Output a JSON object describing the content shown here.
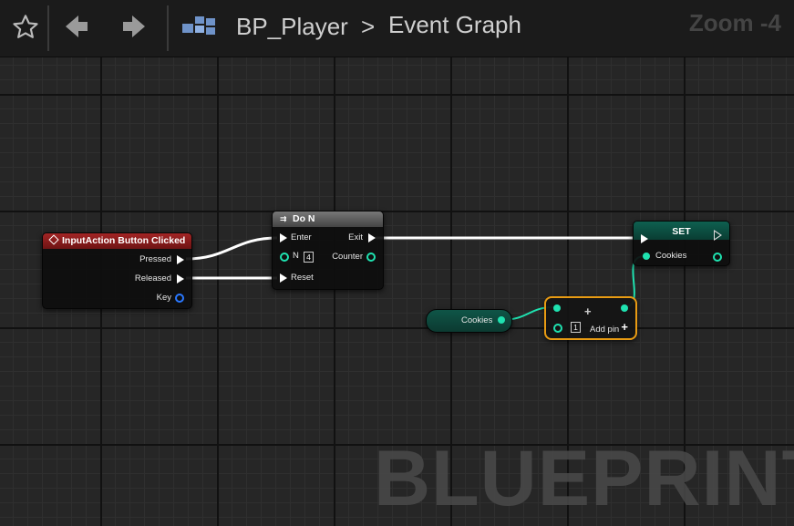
{
  "toolbar": {
    "breadcrumb": {
      "blueprint": "BP_Player",
      "separator": ">",
      "graph": "Event Graph"
    },
    "zoom_label": "Zoom -4"
  },
  "watermark": "BLUEPRINT",
  "nodes": {
    "input_action": {
      "title": "InputAction Button Clicked",
      "pins": {
        "pressed": "Pressed",
        "released": "Released",
        "key": "Key"
      }
    },
    "do_n": {
      "title": "Do N",
      "pins": {
        "enter": "Enter",
        "n": "N",
        "n_value": "4",
        "reset": "Reset",
        "exit": "Exit",
        "counter": "Counter"
      }
    },
    "set": {
      "title": "SET",
      "pins": {
        "cookies": "Cookies"
      }
    },
    "cookies_getter": {
      "label": "Cookies"
    },
    "add": {
      "symbol": "+",
      "b_value": "1",
      "add_pin_label": "Add pin",
      "add_pin_symbol": "+"
    }
  },
  "colors": {
    "event_header": "#8c1e1e",
    "exec_wire": "#ffffff",
    "int_wire": "#1fe2b0",
    "selection_outline": "#e89b13",
    "struct_pin": "#2a78ff"
  },
  "icons": {
    "favorite": "star-icon",
    "back": "arrow-left-icon",
    "forward": "arrow-right-icon",
    "graph": "blueprint-graph-icon",
    "macro": "macro-icon",
    "event": "event-diamond-icon"
  }
}
